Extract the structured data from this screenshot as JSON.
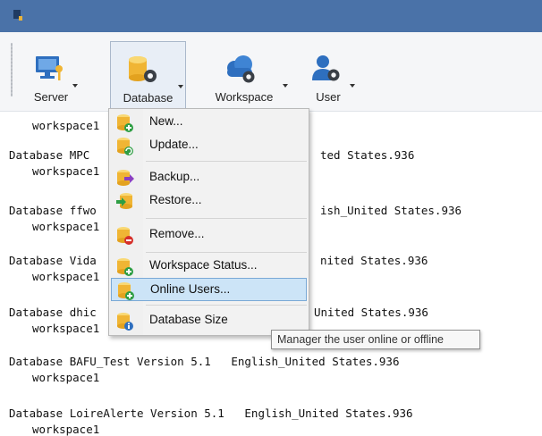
{
  "colors": {
    "titlebar": "#4a72a8",
    "selected_bg": "#cce4f7",
    "selected_border": "#7aa9d6"
  },
  "ribbon": {
    "buttons": [
      {
        "label": "Server",
        "icon": "monitor-key-icon"
      },
      {
        "label": "Database",
        "icon": "database-gear-icon"
      },
      {
        "label": "Workspace",
        "icon": "cloud-gear-icon"
      },
      {
        "label": "User",
        "icon": "user-gear-icon"
      }
    ]
  },
  "console": {
    "lines": [
      "workspace1",
      "Database MPC",
      "workspace1",
      "Database ffwo",
      "workspace1",
      "Database Vida",
      "workspace1",
      "Database dhic",
      "workspace1",
      "Database BAFU_Test Version 5.1   English_United States.936",
      "workspace1",
      "Database LoireAlerte Version 5.1   English_United States.936",
      "workspace1"
    ],
    "right_fragments": [
      "ted States.936",
      "ish_United States.936",
      "nited States.936",
      "United States.936"
    ]
  },
  "menu": {
    "items": [
      {
        "label": "New...",
        "icon": "database-add-icon"
      },
      {
        "label": "Update...",
        "icon": "database-refresh-icon"
      },
      {
        "label": "Backup...",
        "icon": "database-backup-icon"
      },
      {
        "label": "Restore...",
        "icon": "database-restore-icon"
      },
      {
        "label": "Remove...",
        "icon": "database-remove-icon"
      },
      {
        "label": "Workspace Status...",
        "icon": "database-status-icon"
      },
      {
        "label": "Online Users...",
        "icon": "database-users-icon"
      },
      {
        "label": "Database Size",
        "icon": "database-info-icon"
      }
    ],
    "selected": "Online Users..."
  },
  "tooltip": {
    "text": "Manager the user online or offline"
  }
}
